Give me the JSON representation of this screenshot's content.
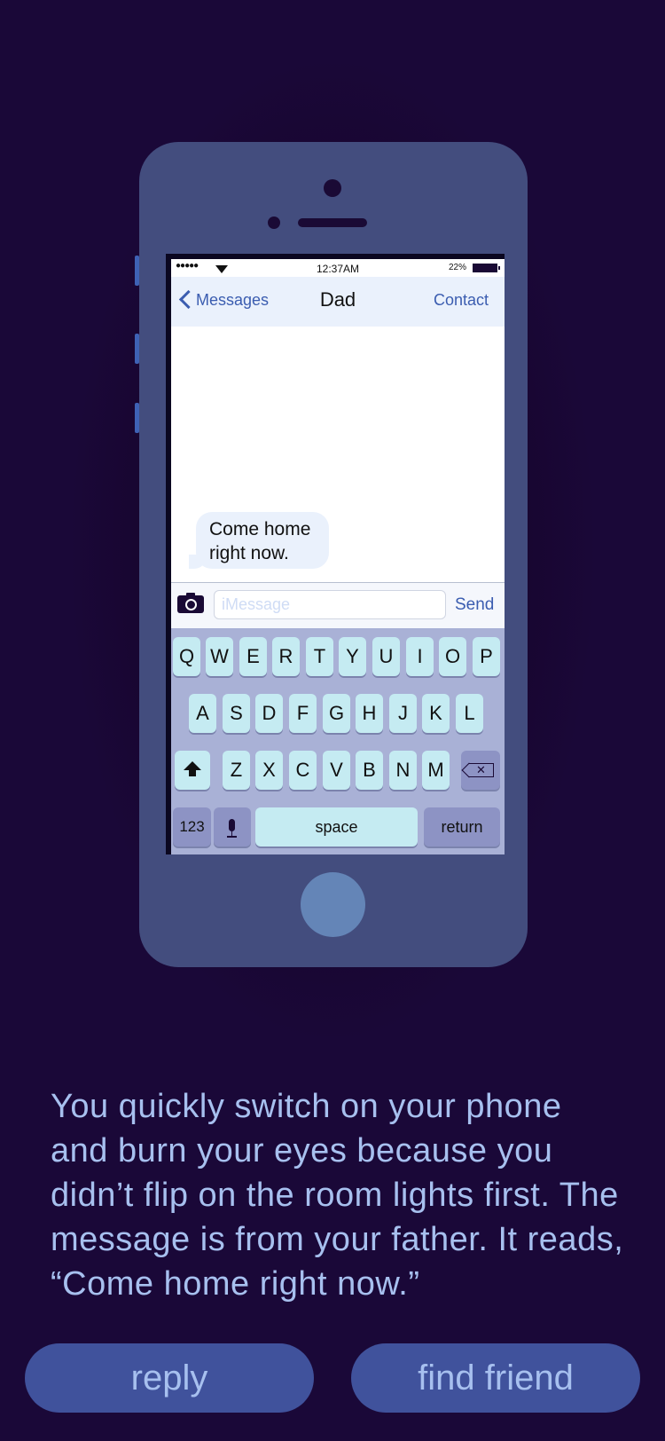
{
  "status_bar": {
    "signal": "●●●●●",
    "time": "12:37AM",
    "battery_percent": "22%"
  },
  "nav": {
    "back_label": "Messages",
    "title": "Dad",
    "contact_label": "Contact"
  },
  "messages": [
    {
      "line1": "Come home",
      "line2": "right now."
    }
  ],
  "compose": {
    "placeholder": "iMessage",
    "value": "",
    "send_label": "Send"
  },
  "keyboard": {
    "row1": [
      "Q",
      "W",
      "E",
      "R",
      "T",
      "Y",
      "U",
      "I",
      "O",
      "P"
    ],
    "row2": [
      "A",
      "S",
      "D",
      "F",
      "G",
      "H",
      "J",
      "K",
      "L"
    ],
    "row3": [
      "Z",
      "X",
      "C",
      "V",
      "B",
      "N",
      "M"
    ],
    "numbers_label": "123",
    "space_label": "space",
    "return_label": "return"
  },
  "story": {
    "text": "You quickly switch on your phone and burn your eyes because you didn’t flip on the room lights first. The message is from your father. It reads, “Come home right now.”"
  },
  "choices": [
    {
      "label": "reply"
    },
    {
      "label": "find friend"
    }
  ],
  "colors": {
    "background": "#1a0838",
    "phone_body": "#434d7e",
    "accent_text": "#a7c0ef",
    "button": "#40529c",
    "key": "#c5ebf2",
    "ios_blue": "#3b5db0"
  }
}
